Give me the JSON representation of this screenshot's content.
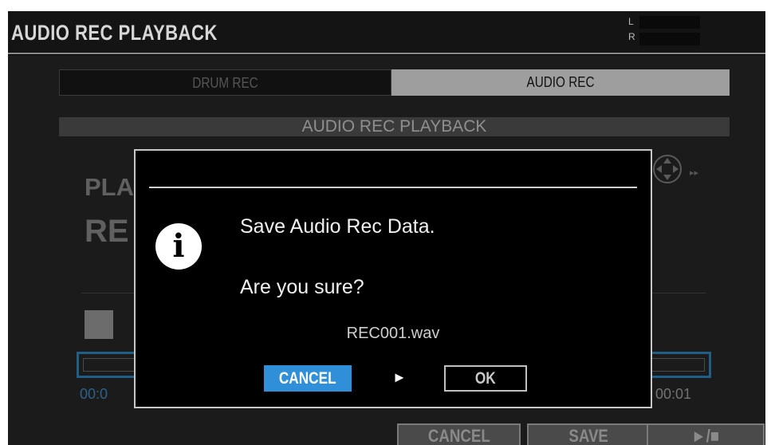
{
  "header": {
    "title": "AUDIO REC PLAYBACK",
    "meter_left_label": "L",
    "meter_right_label": "R"
  },
  "tabs": [
    {
      "label": "DRUM REC",
      "active": false
    },
    {
      "label": "AUDIO REC",
      "active": true
    }
  ],
  "section_title": "AUDIO REC PLAYBACK",
  "background": {
    "play_label_partial": "PLA",
    "rec_label_partial": "RE",
    "time_start_partial": "00:0",
    "time_end": "00:01",
    "play_ff_glyph": "▸▸"
  },
  "bottom_buttons": {
    "cancel": "CANCEL",
    "save": "SAVE",
    "play_stop": "►/■"
  },
  "dialog": {
    "icon": "info-icon",
    "message_line1": "Save Audio Rec Data.",
    "message_line2": "Are you sure?",
    "filename": "REC001.wav",
    "cancel_label": "CANCEL",
    "arrow_glyph": "►",
    "ok_label": "OK",
    "focused": "cancel"
  },
  "colors": {
    "accent_blue": "#2f8fd8",
    "active_tab": "#9e9e9e",
    "progress_border": "#1f5e86"
  }
}
